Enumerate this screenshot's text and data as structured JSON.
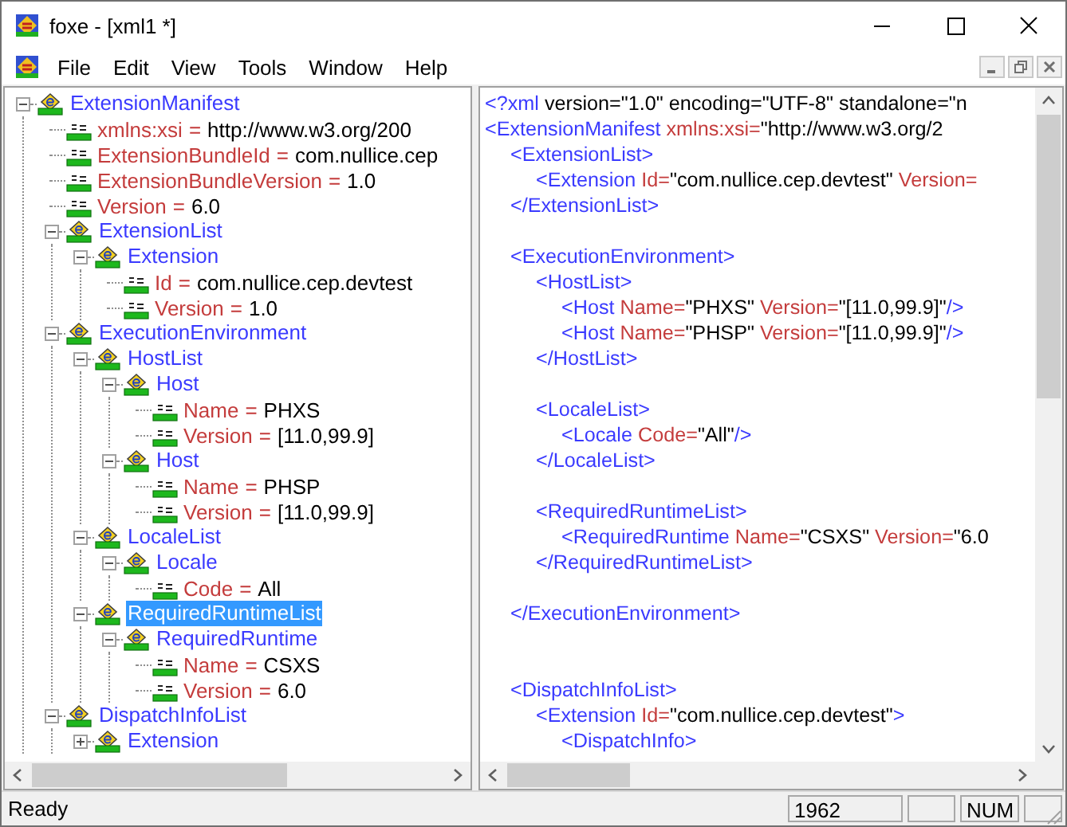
{
  "window": {
    "title": "foxe - [xml1 *]"
  },
  "menu": [
    "File",
    "Edit",
    "View",
    "Tools",
    "Window",
    "Help"
  ],
  "tree": [
    {
      "kind": "element",
      "name": "ExtensionManifest",
      "expanded": true,
      "selected": false,
      "children": [
        {
          "kind": "attribute",
          "name": "xmlns:xsi",
          "separator": "=",
          "value": "http://www.w3.org/200"
        },
        {
          "kind": "attribute",
          "name": "ExtensionBundleId",
          "separator": "=",
          "value": "com.nullice.cep"
        },
        {
          "kind": "attribute",
          "name": "ExtensionBundleVersion",
          "separator": "=",
          "value": "1.0"
        },
        {
          "kind": "attribute",
          "name": "Version",
          "separator": "=",
          "value": "6.0"
        },
        {
          "kind": "element",
          "name": "ExtensionList",
          "expanded": true,
          "selected": false,
          "children": [
            {
              "kind": "element",
              "name": "Extension",
              "expanded": true,
              "selected": false,
              "children": [
                {
                  "kind": "attribute",
                  "name": "Id",
                  "separator": "=",
                  "value": "com.nullice.cep.devtest"
                },
                {
                  "kind": "attribute",
                  "name": "Version",
                  "separator": "=",
                  "value": "1.0"
                }
              ]
            }
          ]
        },
        {
          "kind": "element",
          "name": "ExecutionEnvironment",
          "expanded": true,
          "selected": false,
          "children": [
            {
              "kind": "element",
              "name": "HostList",
              "expanded": true,
              "selected": false,
              "children": [
                {
                  "kind": "element",
                  "name": "Host",
                  "expanded": true,
                  "selected": false,
                  "children": [
                    {
                      "kind": "attribute",
                      "name": "Name",
                      "separator": "=",
                      "value": "PHXS"
                    },
                    {
                      "kind": "attribute",
                      "name": "Version",
                      "separator": "=",
                      "value": "[11.0,99.9]"
                    }
                  ]
                },
                {
                  "kind": "element",
                  "name": "Host",
                  "expanded": true,
                  "selected": false,
                  "children": [
                    {
                      "kind": "attribute",
                      "name": "Name",
                      "separator": "=",
                      "value": "PHSP"
                    },
                    {
                      "kind": "attribute",
                      "name": "Version",
                      "separator": "=",
                      "value": "[11.0,99.9]"
                    }
                  ]
                }
              ]
            },
            {
              "kind": "element",
              "name": "LocaleList",
              "expanded": true,
              "selected": false,
              "children": [
                {
                  "kind": "element",
                  "name": "Locale",
                  "expanded": true,
                  "selected": false,
                  "children": [
                    {
                      "kind": "attribute",
                      "name": "Code",
                      "separator": "=",
                      "value": "All"
                    }
                  ]
                }
              ]
            },
            {
              "kind": "element",
              "name": "RequiredRuntimeList",
              "expanded": true,
              "selected": true,
              "children": [
                {
                  "kind": "element",
                  "name": "RequiredRuntime",
                  "expanded": true,
                  "selected": false,
                  "children": [
                    {
                      "kind": "attribute",
                      "name": "Name",
                      "separator": "=",
                      "value": "CSXS"
                    },
                    {
                      "kind": "attribute",
                      "name": "Version",
                      "separator": "=",
                      "value": "6.0"
                    }
                  ]
                }
              ]
            }
          ]
        },
        {
          "kind": "element",
          "name": "DispatchInfoList",
          "expanded": true,
          "selected": false,
          "children": [
            {
              "kind": "element",
              "name": "Extension",
              "expanded": false,
              "selected": false
            }
          ]
        }
      ]
    }
  ],
  "code": [
    {
      "kind": "code",
      "tokens": [
        {
          "kind": "tag",
          "text": "<?xml"
        },
        {
          "kind": "value",
          "text": " version=\"1.0\" encoding=\"UTF-8\" standalone=\"n"
        }
      ]
    },
    {
      "kind": "code",
      "tokens": [
        {
          "kind": "tag",
          "text": "<ExtensionManifest"
        },
        {
          "kind": "attr",
          "text": " xmlns:xsi="
        },
        {
          "kind": "value",
          "text": "\"http://www.w3.org/2"
        }
      ],
      "children": [
        {
          "kind": "code",
          "tokens": [
            {
              "kind": "tag",
              "text": "<ExtensionList>"
            }
          ],
          "children": [
            {
              "kind": "code",
              "tokens": [
                {
                  "kind": "tag",
                  "text": "<Extension"
                },
                {
                  "kind": "attr",
                  "text": " Id="
                },
                {
                  "kind": "value",
                  "text": "\"com.nullice.cep.devtest\""
                },
                {
                  "kind": "attr",
                  "text": " Version="
                }
              ]
            }
          ]
        },
        {
          "kind": "code",
          "tokens": [
            {
              "kind": "tag",
              "text": "</ExtensionList>"
            }
          ]
        },
        {
          "kind": "blank"
        },
        {
          "kind": "code",
          "tokens": [
            {
              "kind": "tag",
              "text": "<ExecutionEnvironment>"
            }
          ],
          "children": [
            {
              "kind": "code",
              "tokens": [
                {
                  "kind": "tag",
                  "text": "<HostList>"
                }
              ],
              "children": [
                {
                  "kind": "code",
                  "tokens": [
                    {
                      "kind": "tag",
                      "text": "<Host"
                    },
                    {
                      "kind": "attr",
                      "text": " Name="
                    },
                    {
                      "kind": "value",
                      "text": "\"PHXS\""
                    },
                    {
                      "kind": "attr",
                      "text": " Version="
                    },
                    {
                      "kind": "value",
                      "text": "\"[11.0,99.9]\""
                    },
                    {
                      "kind": "tag",
                      "text": "/>"
                    }
                  ]
                },
                {
                  "kind": "code",
                  "tokens": [
                    {
                      "kind": "tag",
                      "text": "<Host"
                    },
                    {
                      "kind": "attr",
                      "text": " Name="
                    },
                    {
                      "kind": "value",
                      "text": "\"PHSP\""
                    },
                    {
                      "kind": "attr",
                      "text": " Version="
                    },
                    {
                      "kind": "value",
                      "text": "\"[11.0,99.9]\""
                    },
                    {
                      "kind": "tag",
                      "text": "/>"
                    }
                  ]
                }
              ]
            },
            {
              "kind": "code",
              "tokens": [
                {
                  "kind": "tag",
                  "text": "</HostList>"
                }
              ]
            },
            {
              "kind": "blank"
            },
            {
              "kind": "code",
              "tokens": [
                {
                  "kind": "tag",
                  "text": "<LocaleList>"
                }
              ],
              "children": [
                {
                  "kind": "code",
                  "tokens": [
                    {
                      "kind": "tag",
                      "text": "<Locale"
                    },
                    {
                      "kind": "attr",
                      "text": " Code="
                    },
                    {
                      "kind": "value",
                      "text": "\"All\""
                    },
                    {
                      "kind": "tag",
                      "text": "/>"
                    }
                  ]
                }
              ]
            },
            {
              "kind": "code",
              "tokens": [
                {
                  "kind": "tag",
                  "text": "</LocaleList>"
                }
              ]
            },
            {
              "kind": "blank"
            },
            {
              "kind": "code",
              "tokens": [
                {
                  "kind": "tag",
                  "text": "<RequiredRuntimeList>"
                }
              ],
              "children": [
                {
                  "kind": "code",
                  "tokens": [
                    {
                      "kind": "tag",
                      "text": "<RequiredRuntime"
                    },
                    {
                      "kind": "attr",
                      "text": " Name="
                    },
                    {
                      "kind": "value",
                      "text": "\"CSXS\""
                    },
                    {
                      "kind": "attr",
                      "text": " Version="
                    },
                    {
                      "kind": "value",
                      "text": "\"6.0"
                    }
                  ]
                }
              ]
            },
            {
              "kind": "code",
              "tokens": [
                {
                  "kind": "tag",
                  "text": "</RequiredRuntimeList>"
                }
              ]
            },
            {
              "kind": "blank"
            }
          ]
        },
        {
          "kind": "code",
          "tokens": [
            {
              "kind": "tag",
              "text": "</ExecutionEnvironment>"
            }
          ]
        },
        {
          "kind": "blank"
        },
        {
          "kind": "blank"
        },
        {
          "kind": "code",
          "tokens": [
            {
              "kind": "tag",
              "text": "<DispatchInfoList>"
            }
          ],
          "children": [
            {
              "kind": "code",
              "tokens": [
                {
                  "kind": "tag",
                  "text": "<Extension"
                },
                {
                  "kind": "attr",
                  "text": " Id="
                },
                {
                  "kind": "value",
                  "text": "\"com.nullice.cep.devtest\""
                },
                {
                  "kind": "tag",
                  "text": ">"
                }
              ],
              "children": [
                {
                  "kind": "code",
                  "tokens": [
                    {
                      "kind": "tag",
                      "text": "<DispatchInfo>"
                    }
                  ]
                }
              ]
            }
          ]
        }
      ]
    }
  ],
  "status_bar": {
    "message": "Ready",
    "panels": [
      {
        "kind": "text",
        "text": "1962"
      },
      {
        "kind": "empty"
      },
      {
        "kind": "text",
        "text": "NUM"
      },
      {
        "kind": "empty"
      }
    ]
  }
}
